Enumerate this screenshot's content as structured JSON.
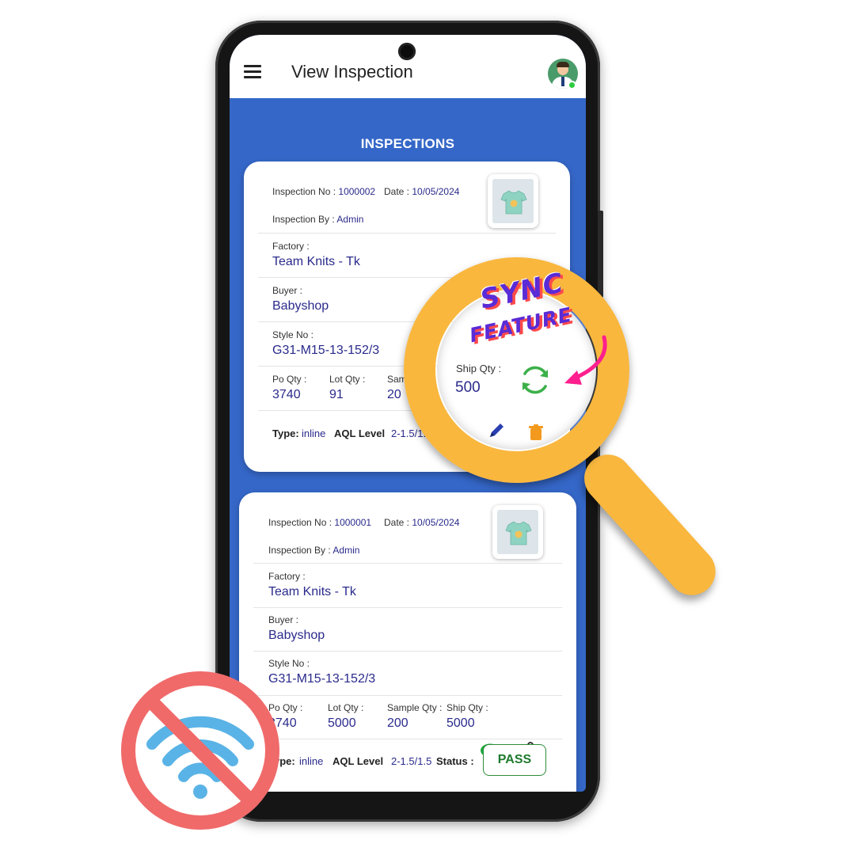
{
  "app": {
    "title": "View Inspection",
    "section_heading": "INSPECTIONS"
  },
  "labels": {
    "inspection_no": "Inspection No :",
    "date": "Date :",
    "inspection_by": "Inspection By :",
    "factory": "Factory :",
    "buyer": "Buyer :",
    "style_no": "Style No :",
    "po_qty": "Po Qty :",
    "lot_qty": "Lot Qty :",
    "sample_qty": "Sample Qty :",
    "sample_qty_partial": "Sam",
    "ship_qty": "Ship Qty :",
    "type": "Type:",
    "aql_level": "AQL Level",
    "status": "Status :",
    "type_partial": "pe:"
  },
  "cards": [
    {
      "inspection_no": "1000002",
      "date": "10/05/2024",
      "inspection_by": "Admin",
      "factory": "Team Knits - Tk",
      "buyer": "Babyshop",
      "style_no": "G31-M15-13-152/3",
      "po_qty": "3740",
      "lot_qty": "91",
      "sample_qty": "20",
      "ship_qty": "500",
      "type": "inline",
      "aql_level": "2-1.5/1."
    },
    {
      "inspection_no": "1000001",
      "date": "10/05/2024",
      "inspection_by": "Admin",
      "factory": "Team Knits - Tk",
      "buyer": "Babyshop",
      "style_no": "G31-M15-13-152/3",
      "po_qty": "3740",
      "po_qty_partial": "740",
      "lot_qty": "5000",
      "sample_qty": "200",
      "ship_qty": "5000",
      "type": "inline",
      "aql_level": "2-1.5/1.5",
      "status": "PASS"
    }
  ],
  "promo": {
    "line1": "SYNC",
    "line2": "FEATURE"
  },
  "icons": {
    "menu": "hamburger-menu-icon",
    "avatar": "user-avatar",
    "edit": "pencil-icon",
    "delete": "trash-icon",
    "view": "eye-icon",
    "share": "share-icon",
    "sync": "sync-icon",
    "offline": "no-wifi-icon"
  },
  "colors": {
    "primary_blue": "#3567c8",
    "value_text": "#2a2a8c",
    "pass_green": "#1f7a2e",
    "magnifier": "#f9b73e",
    "promo_purple": "#5a2bd6",
    "promo_red": "#ff4a4a",
    "arrow_pink": "#ff1f8e",
    "sync_green": "#3cb04a",
    "no_wifi_red": "#f06a6a",
    "wifi_blue": "#5ab3e6"
  }
}
